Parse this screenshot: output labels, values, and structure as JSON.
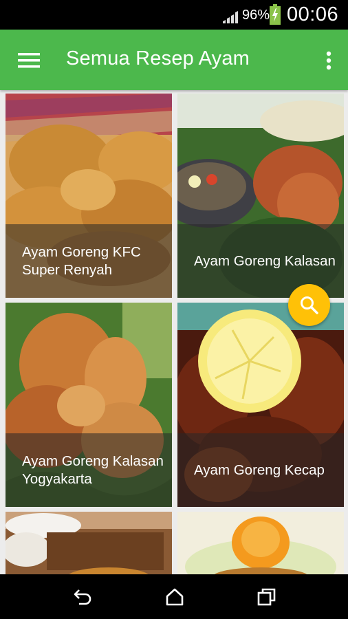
{
  "status_bar": {
    "battery_percent": "96%",
    "time": "00:06",
    "icons": [
      "signal-icon",
      "battery-icon"
    ]
  },
  "app_bar": {
    "title": "Semua Resep Ayam",
    "icons": [
      "menu-icon",
      "more-vert-icon"
    ]
  },
  "recipes": [
    {
      "title": "Ayam Goreng KFC Super Renyah"
    },
    {
      "title": "Ayam Goreng Kalasan"
    },
    {
      "title": "Ayam Goreng Kalasan Yogyakarta"
    },
    {
      "title": "Ayam Goreng Kecap"
    },
    {
      "title": ""
    },
    {
      "title": ""
    }
  ],
  "fab": {
    "icon": "search-icon"
  },
  "nav_bar": {
    "icons": [
      "back-icon",
      "home-icon",
      "recents-icon"
    ]
  },
  "colors": {
    "app_bar": "#4cb84c",
    "fab": "#ffc107",
    "status_bar": "#000000",
    "nav_bar": "#000000"
  }
}
